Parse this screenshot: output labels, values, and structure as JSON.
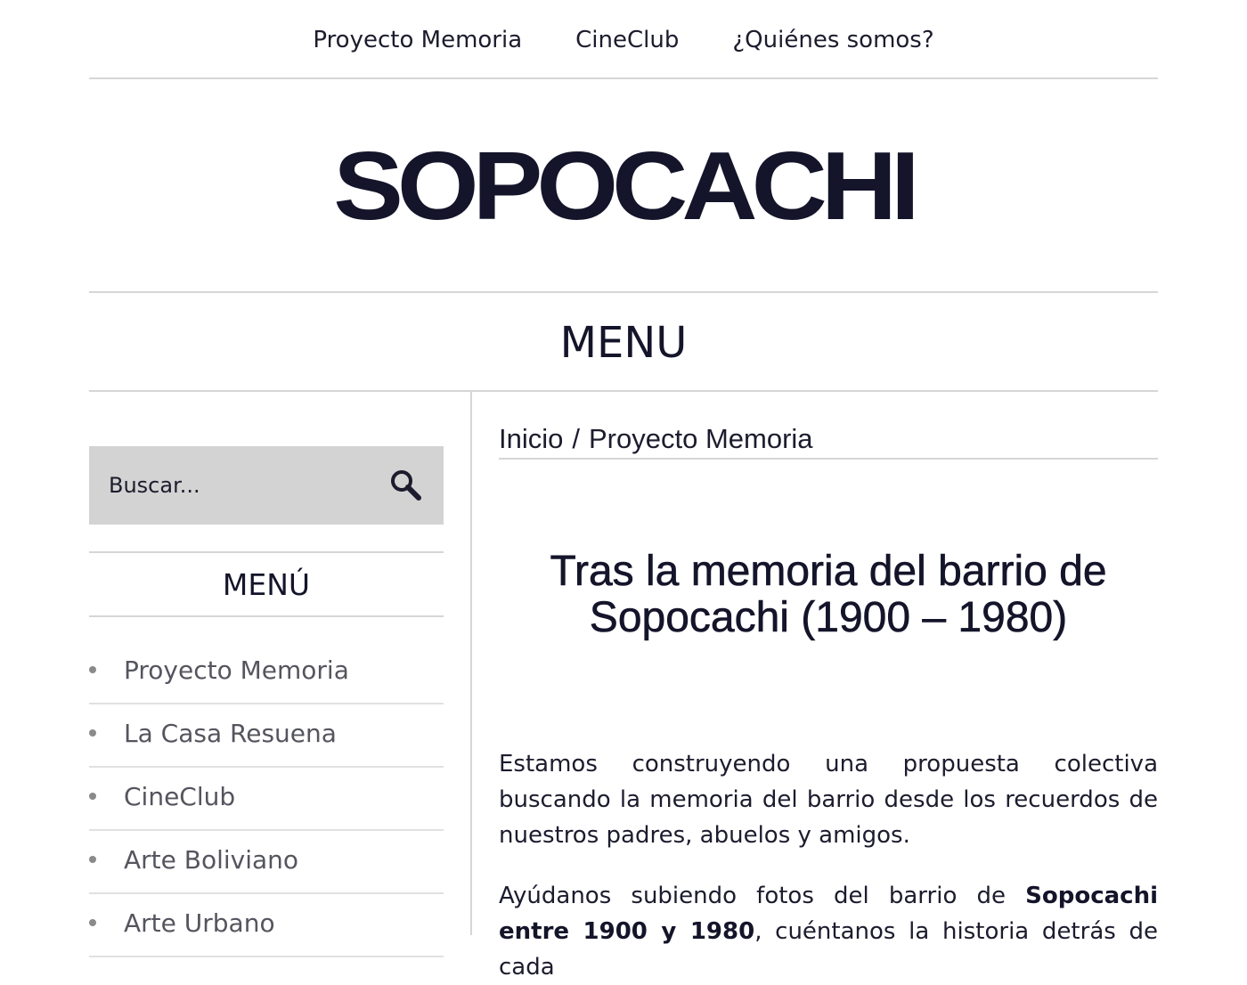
{
  "topnav": {
    "items": [
      {
        "label": "Proyecto Memoria"
      },
      {
        "label": "CineClub"
      },
      {
        "label": "¿Quiénes somos?"
      }
    ]
  },
  "header": {
    "logo_text": "SOPOCACHI",
    "menu_toggle_label": "MENU"
  },
  "sidebar": {
    "search_placeholder": "Buscar...",
    "search_icon": "magnifier-icon",
    "title": "MENÚ",
    "items": [
      {
        "label": "Proyecto Memoria"
      },
      {
        "label": "La Casa Resuena"
      },
      {
        "label": "CineClub"
      },
      {
        "label": "Arte Boliviano"
      },
      {
        "label": "Arte Urbano"
      }
    ]
  },
  "main": {
    "breadcrumb": {
      "home": "Inicio",
      "separator": "/",
      "current": "Proyecto Memoria"
    },
    "title": "Tras la memoria del barrio de Sopocachi (1900 – 1980)",
    "paragraph1": "Estamos construyendo una propuesta colectiva buscando la memoria del barrio desde los recuerdos de nuestros padres, abuelos y amigos.",
    "paragraph2": {
      "prefix": "Ayúdanos subiendo fotos del barrio de ",
      "bold": "Sopocachi entre 1900 y 1980",
      "suffix": ", cuéntanos la historia detrás de cada"
    }
  },
  "colors": {
    "text": "#1c1c2e",
    "heading": "#14142a",
    "divider": "#d6d6d6",
    "search_bg": "#d3d3d3",
    "sidebar_link": "#55555f"
  }
}
